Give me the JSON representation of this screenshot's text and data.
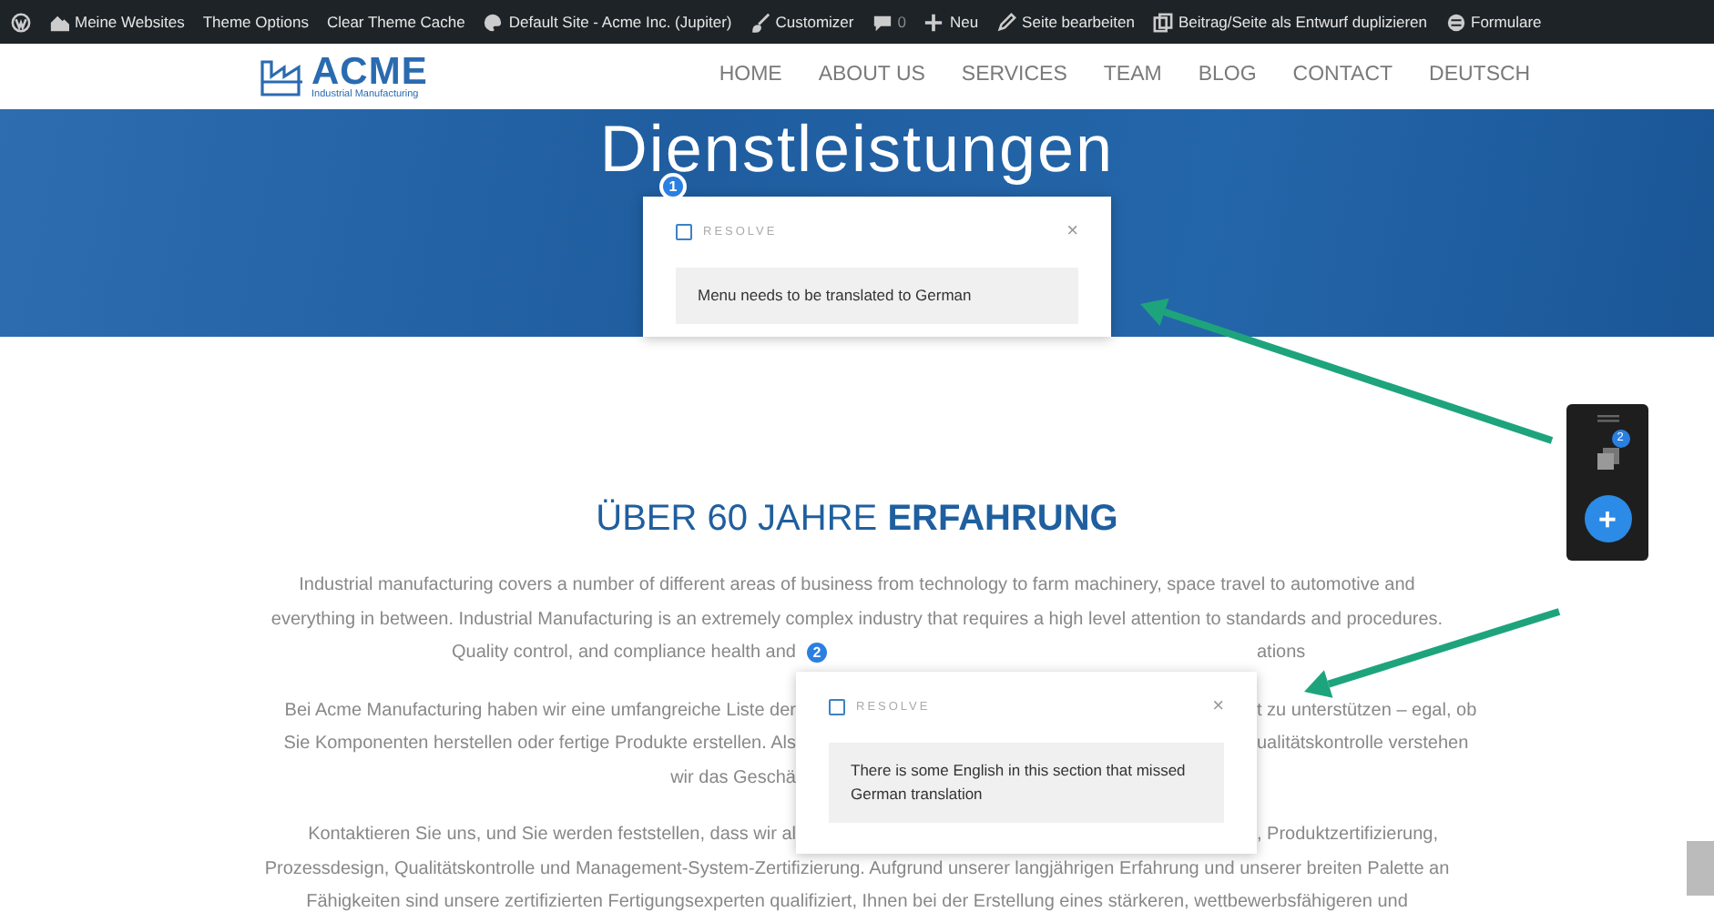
{
  "admin_bar": {
    "items": [
      {
        "kind": "wp-logo"
      },
      {
        "kind": "sites",
        "label": "Meine Websites"
      },
      {
        "kind": "text",
        "label": "Theme Options"
      },
      {
        "kind": "text",
        "label": "Clear Theme Cache"
      },
      {
        "kind": "dashboard",
        "label": "Default Site - Acme Inc. (Jupiter)"
      },
      {
        "kind": "brush",
        "label": "Customizer"
      },
      {
        "kind": "comment",
        "label": "0"
      },
      {
        "kind": "plus",
        "label": "Neu"
      },
      {
        "kind": "pencil",
        "label": "Seite bearbeiten"
      },
      {
        "kind": "duplicate",
        "label": "Beitrag/Seite als Entwurf duplizieren"
      },
      {
        "kind": "form",
        "label": "Formulare"
      }
    ]
  },
  "header": {
    "logo": {
      "name": "ACME",
      "tagline": "Industrial Manufacturing"
    },
    "menu": [
      "HOME",
      "ABOUT US",
      "SERVICES",
      "TEAM",
      "BLOG",
      "CONTACT",
      "DEUTSCH"
    ]
  },
  "hero": {
    "title": "Dienstleistungen"
  },
  "section": {
    "heading": "ÜBER 60 JAHRE **ERFAHRUNG**",
    "paragraphs": [
      [
        {
          "text": "Industrial manufacturing covers a number of different areas of business from technology to farm machinery, space travel to automotive and"
        },
        {
          "text": "everything in between. Industrial Manufacturing is an extremely complex industry that requires a high level attention to standards and procedures."
        },
        {
          "left": "Quality control, and compliance health and",
          "right": "ations"
        }
      ],
      [
        {
          "left": "Bei Acme Manufacturing haben wir eine umfangreiche Liste der",
          "right": "t zu unterstützen – egal, ob"
        },
        {
          "left": "Sie Komponenten herstellen oder fertige Produkte erstellen. Als",
          "right": "ualitätskontrolle verstehen"
        },
        {
          "left": "wir das Geschä"
        }
      ],
      [
        {
          "left": "Kontaktieren Sie uns, und Sie werden feststellen, dass wir al",
          "right": ", Produktzertifizierung,"
        },
        {
          "text": "Prozessdesign, Qualitätskontrolle und Management-System-Zertifizierung. Aufgrund unserer langjährigen Erfahrung und unserer breiten Palette an"
        },
        {
          "text": "Fähigkeiten sind unsere zertifizierten Fertigungsexperten qualifiziert, Ihnen bei der Erstellung eines stärkeren, wettbewerbsfähigeren und"
        }
      ]
    ]
  },
  "comments": [
    {
      "number": "1",
      "resolve_label": "RESOLVE",
      "resolved": false,
      "close": "×",
      "text": "Menu needs to be translated to German"
    },
    {
      "number": "2",
      "resolve_label": "RESOLVE",
      "resolved": false,
      "close": "×",
      "text": "There is some English in this section that missed German translation"
    }
  ],
  "comment_panel": {
    "count": "2",
    "add_button": "+"
  }
}
